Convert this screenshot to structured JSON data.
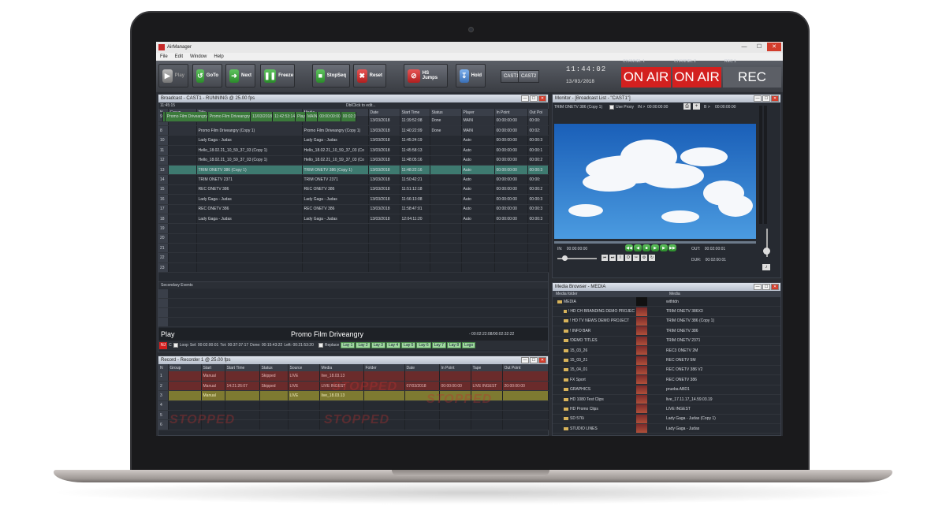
{
  "app": {
    "title": "AirManager",
    "menu": [
      "File",
      "Edit",
      "Window",
      "Help"
    ]
  },
  "toolbar": {
    "play": "Play",
    "goto": "GoTo",
    "next": "Next",
    "freeze": "Freeze",
    "stopseq": "StopSeq",
    "reset": "Reset",
    "hs_jumps": "HS Jumps",
    "hold": "Hold",
    "cast1": "CAST1",
    "cast2": "CAST2"
  },
  "clock": {
    "time": "11:44:02",
    "date": "13/03/2018"
  },
  "status": {
    "channel1_label": "CHANNEL 1",
    "channel1_text": "ON AIR",
    "channel2_label": "CHANNEL 2",
    "channel2_text": "ON AIR",
    "rec1_label": "REC 1",
    "rec1_text": "REC",
    "onair_color": "#d3201f",
    "rec_color": "#5c5f66"
  },
  "broadcast": {
    "title": "Broadcast - CAST1 - RUNNING @ 25.00 fps",
    "time": "11:45:15",
    "hint": "DblClick to edit...",
    "columns": [
      "N",
      "Group",
      "Title",
      "Media",
      "Date",
      "Start Time",
      "Status",
      "Player",
      "In Point",
      "Out Poi"
    ],
    "rows": [
      [
        "7",
        "",
        "TRIM ONETV 2371",
        "TRIM ONETV 2371",
        "13/03/2018",
        "11:39:52:08",
        "Done",
        "MAIN",
        "00:00:00:00",
        "00:00:"
      ],
      [
        "8",
        "",
        "Promo Film Driveangry (Copy 1)",
        "Promo Film Driveangry (Copy 1)",
        "13/03/2018",
        "11:40:22:09",
        "Done",
        "MAIN",
        "00:00:00:00",
        "00:02:"
      ],
      [
        "9",
        "",
        "Promo Film Driveangry",
        "Promo Film Driveangry",
        "13/03/2018",
        "11:42:53:14",
        "Play",
        "MAIN",
        "00:00:00:00",
        "00:02:3"
      ],
      [
        "10",
        "",
        "Lady Gaga - Judas",
        "Lady Gaga - Judas",
        "13/03/2018",
        "11:45:24:19",
        "",
        "Auto",
        "00:00:00:00",
        "00:00:3"
      ],
      [
        "11",
        "",
        "Hello_18.02.21_10_59_37_03 (Copy 1)",
        "Hello_18.02.21_10_59_37_03 (Co",
        "13/03/2018",
        "11:45:58:13",
        "",
        "Auto",
        "00:00:00:00",
        "00:00:1"
      ],
      [
        "12",
        "",
        "Hello_18.02.21_10_59_37_03 (Copy 1)",
        "Hello_18.02.21_10_59_37_03 (Co",
        "13/03/2018",
        "11:48:05:16",
        "",
        "Auto",
        "00:00:00:00",
        "00:00:2"
      ],
      [
        "13",
        "",
        "TRIM ONETV 386 (Copy 1)",
        "TRIM ONETV 386 (Copy 1)",
        "13/03/2018",
        "11:48:22:16",
        "",
        "Auto",
        "00:00:00:00",
        "00:00:3"
      ],
      [
        "14",
        "",
        "TRIM ONETV 2371",
        "TRIM ONETV 2371",
        "13/03/2018",
        "11:50:42:21",
        "",
        "Auto",
        "00:00:00:00",
        "00:00:"
      ],
      [
        "15",
        "",
        "REC ONETV 386",
        "REC ONETV 386",
        "13/03/2018",
        "11:51:12:18",
        "",
        "Auto",
        "00:00:00:00",
        "00:00:2"
      ],
      [
        "16",
        "",
        "Lady Gaga - Judas",
        "Lady Gaga - Judas",
        "13/03/2018",
        "11:56:13:08",
        "",
        "Auto",
        "00:00:00:00",
        "00:00:3"
      ],
      [
        "17",
        "",
        "REC ONETV 386",
        "REC ONETV 386",
        "13/03/2018",
        "11:58:47:01",
        "",
        "Auto",
        "00:00:00:00",
        "00:00:3"
      ],
      [
        "18",
        "",
        "Lady Gaga - Judas",
        "Lady Gaga - Judas",
        "13/03/2018",
        "12:04:11:20",
        "",
        "Auto",
        "00:00:00:00",
        "00:00:3"
      ],
      [
        "19",
        "",
        "",
        "",
        "",
        "",
        "",
        "",
        "",
        ""
      ],
      [
        "20",
        "",
        "",
        "",
        "",
        "",
        "",
        "",
        "",
        ""
      ],
      [
        "21",
        "",
        "",
        "",
        "",
        "",
        "",
        "",
        "",
        ""
      ],
      [
        "22",
        "",
        "",
        "",
        "",
        "",
        "",
        "",
        "",
        ""
      ],
      [
        "23",
        "",
        "",
        "",
        "",
        "",
        "",
        "",
        "",
        ""
      ]
    ],
    "secondary_label": "Secondary Events",
    "play_label": "Play",
    "now_playing": "Promo Film Driveangry",
    "remaining": "- 00:02:22:08/00:02:32:22",
    "status_line": {
      "nj": "NJ",
      "c": "C",
      "loop": "Loop",
      "sel": "Sel: 00:02:00:01",
      "tot": "Tot: 00:37:37:17",
      "done": "Done: 00:15:43:22",
      "left": "Left: 00:21:53:20",
      "replace": "Replace",
      "lays": [
        "Lay 1",
        "Lay 2",
        "Lay 3",
        "Lay 4",
        "Lay 5",
        "Lay 6",
        "Lay 7",
        "Lay 8",
        "Logo"
      ]
    }
  },
  "monitor": {
    "title": "Monitor - [Broadcast List - \"CAST1\"]",
    "source": "TRIM ONETV 386 (Copy 1)",
    "use_proxy": "Use Proxy",
    "in_label": "IN >",
    "in_tc_top": "00:00:00:00",
    "b_label": "B >",
    "b_tc_top": "00:00:00:00",
    "in_point_label": "IN:",
    "in_point": "00:00:00:00",
    "out_label": "OUT:",
    "out_point": "00:02:00:01",
    "dur_label": "DUR:",
    "dur": "00:02:00:01"
  },
  "media_browser": {
    "title": "Media Browser - MEDIA",
    "col_folder": "Media folder",
    "col_media": "Media",
    "folders": [
      "MEDIA",
      "! HD CH BRANDING DEMO PROJEC",
      "! HD TV NEWS DEMO PROJECT",
      "! INFO BAR",
      "!DEMO TITLES",
      "15_03_26",
      "15_03_21",
      "15_04_01",
      "FX Sport",
      "GRAPHICS",
      "HD 1080 Test Clips",
      "HD Promo Clips",
      "SD 576i",
      "STUDIO LINES"
    ],
    "media": [
      "withtdn",
      "TRIM ONETV 386X3",
      "TRIM ONETV 386 (Copy 1)",
      "TRIM ONETV 386",
      "TRIM ONETV 2371",
      "REC3 ONETV 2M",
      "REC ONETV 5M",
      "REC ONETV 386 V2",
      "REC ONETV 386",
      "prueba ABD1",
      "live_17.11.17_14.59.03.19",
      "LIVE INGEST",
      "Lady Gaga - Judas (Copy 1)",
      "Lady Gaga - Judas"
    ]
  },
  "record": {
    "title": "Record - Recorder 1 @ 25.00 fps",
    "columns": [
      "N",
      "Group",
      "Start",
      "Start Time",
      "Status",
      "Source",
      "Media",
      "Folder",
      "Date",
      "In Point",
      "Tape",
      "Out Point"
    ],
    "rows": [
      [
        "1",
        "",
        "Manual",
        "",
        "Skipped",
        "LIVE",
        "live_18.03.13",
        "",
        "",
        "",
        "",
        ""
      ],
      [
        "2",
        "",
        "Manual",
        "14:21:26:07",
        "Skipped",
        "LIVE",
        "LIVE INGEST",
        "",
        "07/03/2018",
        "00:00:00:00",
        "LIVE INGEST",
        "20:00:00:00"
      ],
      [
        "3",
        "",
        "Manual",
        "",
        "",
        "LIVE",
        "live_18.03.13",
        "",
        "",
        "",
        "",
        ""
      ],
      [
        "4",
        "",
        "",
        "",
        "",
        "",
        "",
        "",
        "",
        "",
        "",
        ""
      ],
      [
        "5",
        "",
        "",
        "",
        "",
        "",
        "",
        "",
        "",
        "",
        "",
        ""
      ],
      [
        "6",
        "",
        "",
        "",
        "",
        "",
        "",
        "",
        "",
        "",
        "",
        ""
      ]
    ],
    "watermark": "STOPPED"
  }
}
